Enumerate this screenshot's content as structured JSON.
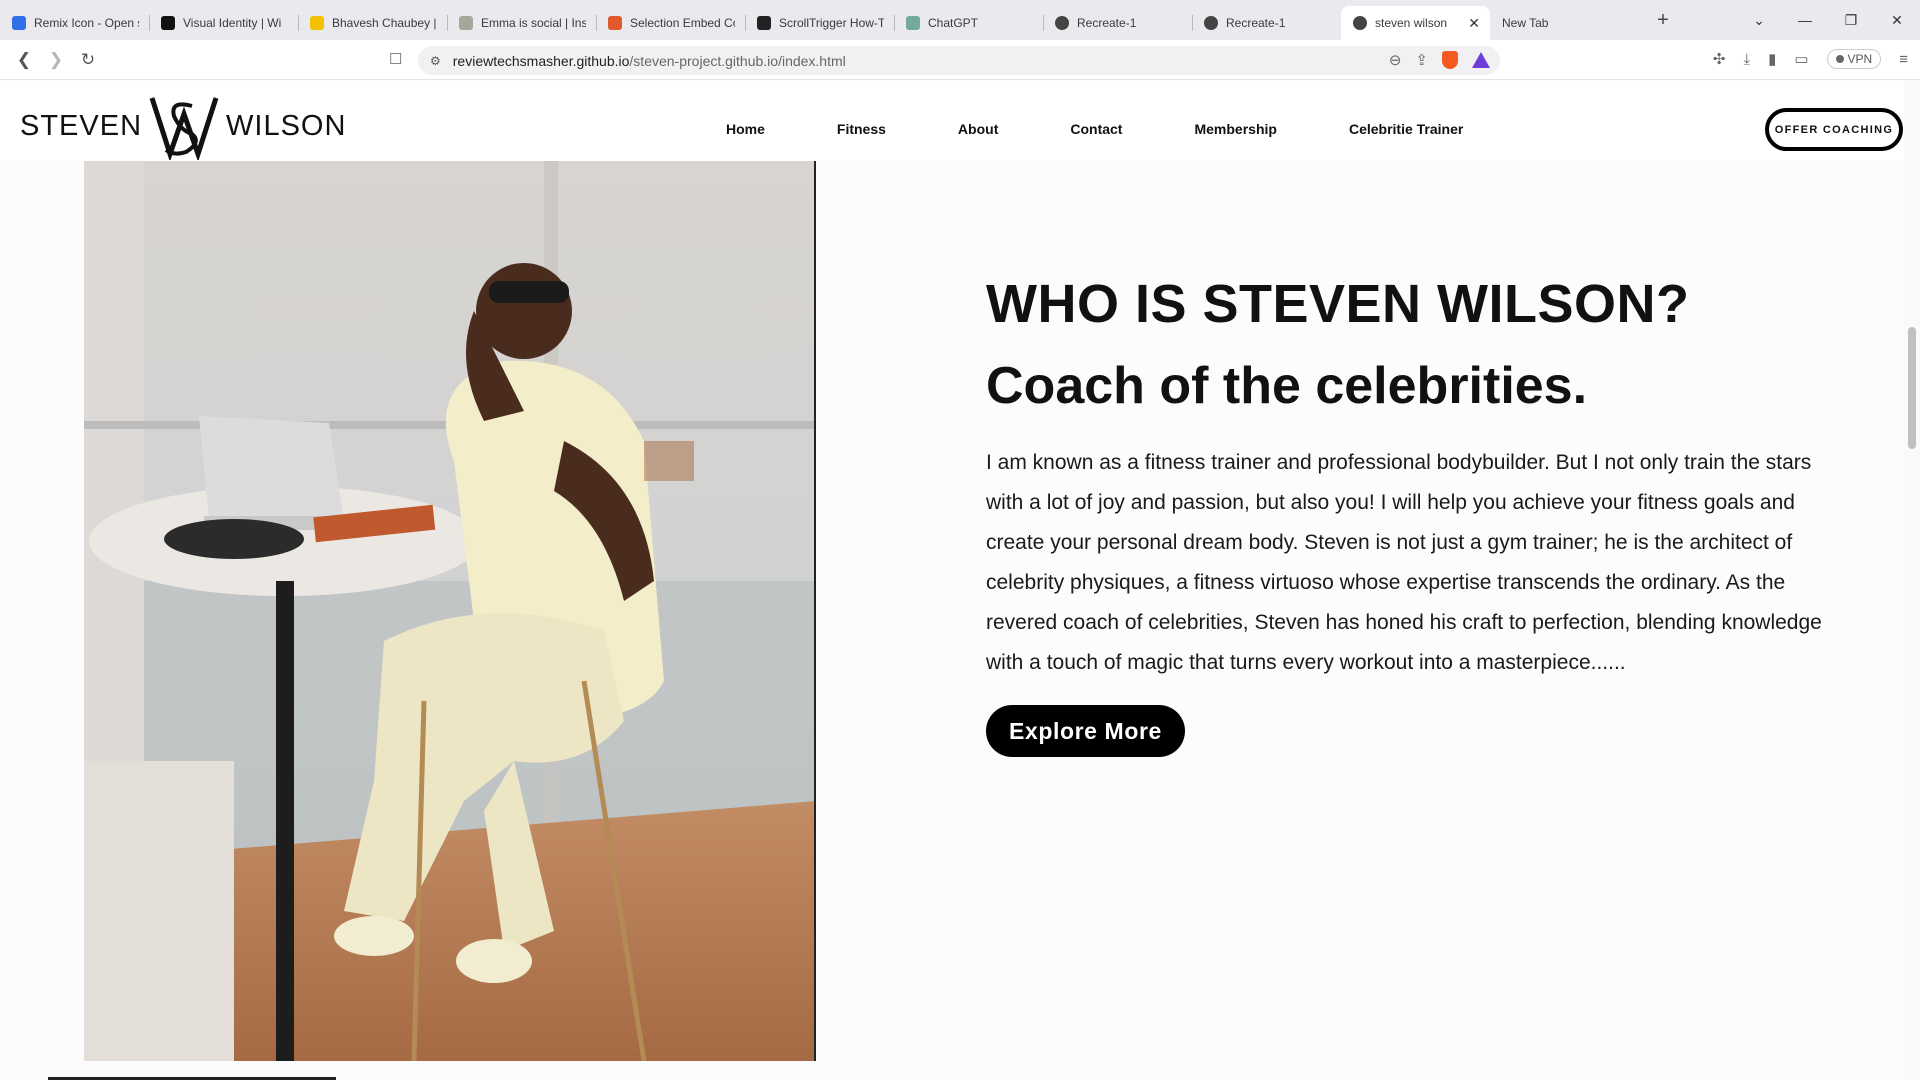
{
  "browser": {
    "tabs": [
      {
        "title": "Remix Icon - Open s",
        "favicon_color": "#2f6fe8"
      },
      {
        "title": "Visual Identity | Wi",
        "favicon_color": "#111111"
      },
      {
        "title": "Bhavesh Chaubey |",
        "favicon_color": "#f2c100"
      },
      {
        "title": "Emma is social | Ins",
        "favicon_color": "#a6a69a"
      },
      {
        "title": "Selection Embed Co",
        "favicon_color": "#e05a2b"
      },
      {
        "title": "ScrollTrigger How-T",
        "favicon_color": "#222222"
      },
      {
        "title": "ChatGPT",
        "favicon_color": "#74aa9c"
      },
      {
        "title": "Recreate-1",
        "favicon_color": "#444444"
      },
      {
        "title": "Recreate-1",
        "favicon_color": "#444444"
      },
      {
        "title": "steven wilson",
        "favicon_color": "#444444",
        "active": true
      },
      {
        "title": "New Tab",
        "favicon_color": ""
      }
    ],
    "url_domain": "reviewtechsmasher.github.io",
    "url_path": "/steven-project.github.io/index.html",
    "vpn_label": "VPN"
  },
  "site": {
    "logo_left": "STEVEN",
    "logo_right": "WILSON",
    "nav": [
      "Home",
      "Fitness",
      "About",
      "Contact",
      "Membership",
      "Celebritie Trainer"
    ],
    "cta": "OFFER COACHING"
  },
  "hero": {
    "heading": "WHO IS STEVEN WILSON?",
    "subheading": "Coach of the celebrities.",
    "paragraph": "I am known as a fitness trainer and professional bodybuilder. But I not only train the stars with a lot of joy and passion, but also you! I will help you achieve your fitness goals and create your personal dream body. Steven is not just a gym trainer; he is the architect of celebrity physiques, a fitness virtuoso whose expertise transcends the ordinary. As the revered coach of celebrities, Steven has honed his craft to perfection, blending knowledge with a touch of magic that turns every workout into a masterpiece......",
    "button": "Explore More"
  }
}
